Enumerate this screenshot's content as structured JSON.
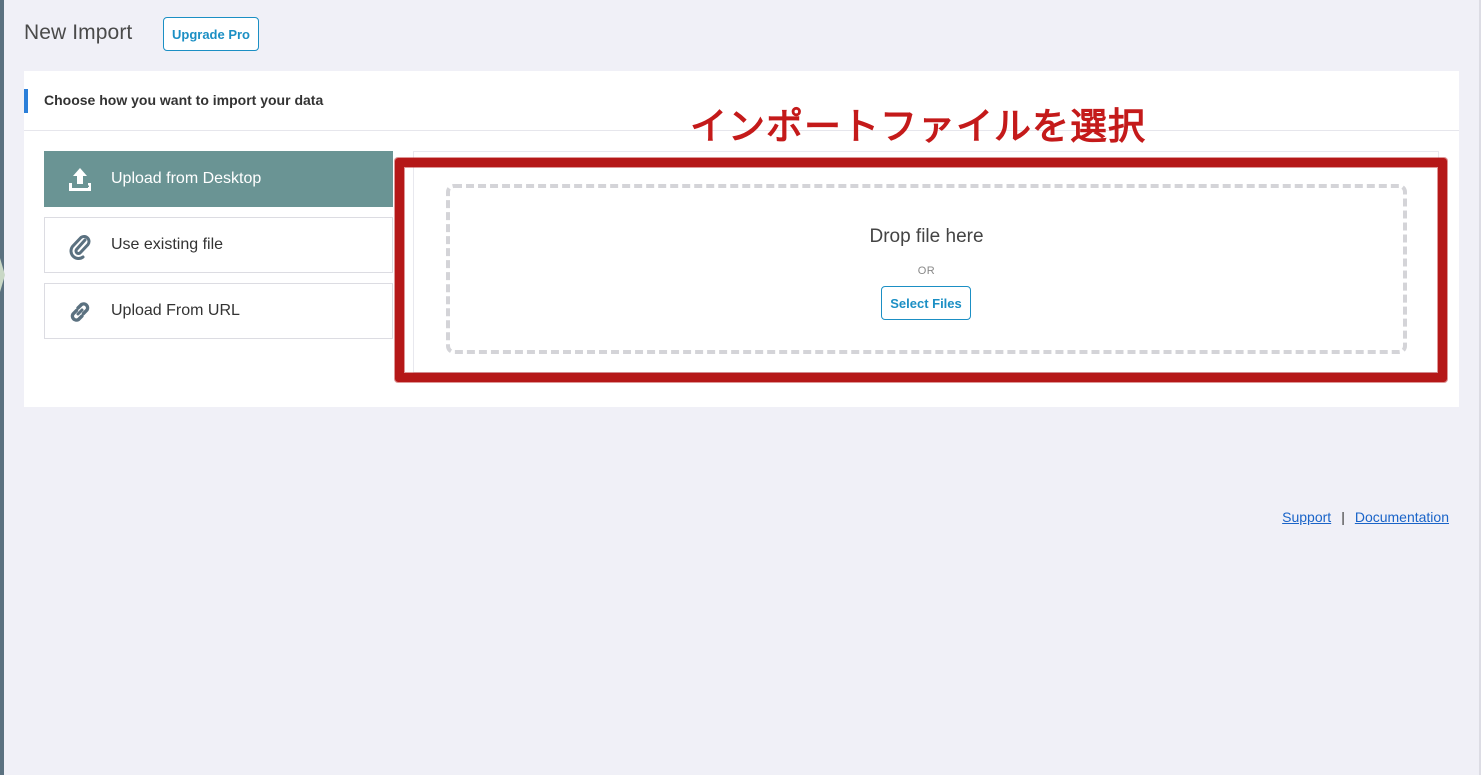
{
  "page": {
    "title": "New Import",
    "upgrade_label": "Upgrade Pro"
  },
  "card": {
    "heading": "Choose how you want to import your data"
  },
  "annotation": {
    "text": "インポートファイルを選択",
    "color": "#c41a1a"
  },
  "sources": [
    {
      "label": "Upload from Desktop",
      "icon": "upload-icon",
      "active": true
    },
    {
      "label": "Use existing file",
      "icon": "paperclip-icon",
      "active": false
    },
    {
      "label": "Upload From URL",
      "icon": "link-icon",
      "active": false
    }
  ],
  "dropzone": {
    "title": "Drop file here",
    "or_label": "OR",
    "select_label": "Select Files"
  },
  "footer": {
    "support_label": "Support",
    "separator": "|",
    "documentation_label": "Documentation"
  },
  "colors": {
    "accent": "#2b7fd9",
    "active_item": "#6a9494",
    "button": "#1b8fc4",
    "annotation_frame": "#b51818"
  }
}
